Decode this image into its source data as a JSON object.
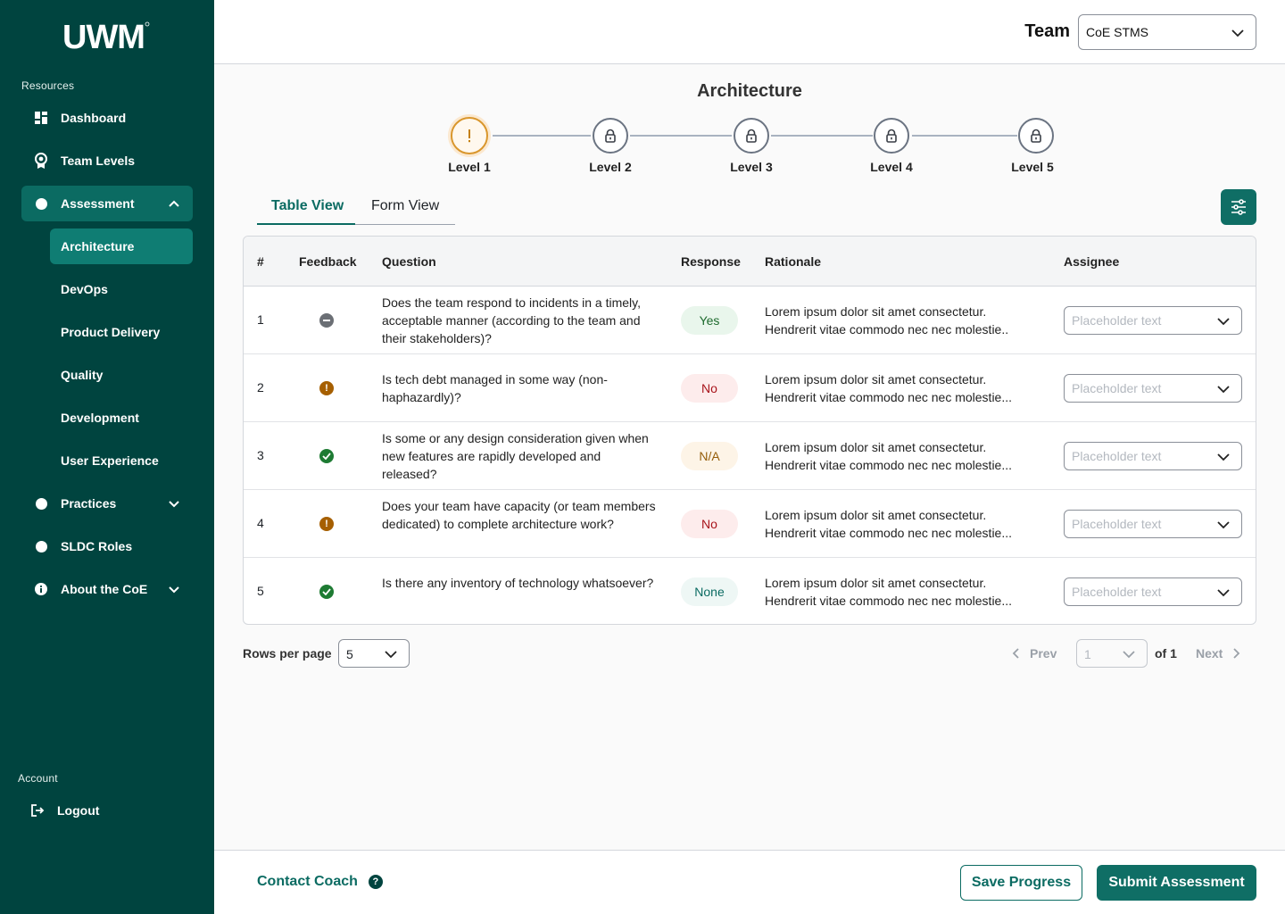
{
  "sidebar": {
    "logo_text": "UWM",
    "resources_label": "Resources",
    "items": {
      "dashboard": "Dashboard",
      "team_levels": "Team Levels",
      "assessment": "Assessment",
      "practices": "Practices",
      "sldc_roles": "SLDC Roles",
      "about": "About the CoE"
    },
    "assessment_subitems": [
      "Architecture",
      "DevOps",
      "Product Delivery",
      "Quality",
      "Development",
      "User Experience"
    ],
    "account_label": "Account",
    "logout": "Logout"
  },
  "header": {
    "team_label": "Team",
    "team_value": "CoE STMS"
  },
  "page": {
    "title": "Architecture",
    "levels": [
      "Level 1",
      "Level 2",
      "Level 3",
      "Level 4",
      "Level 5"
    ],
    "tabs": [
      "Table View",
      "Form View"
    ]
  },
  "table": {
    "headers": [
      "#",
      "Feedback",
      "Question",
      "Response",
      "Rationale",
      "Assignee"
    ],
    "assignee_placeholder": "Placeholder text",
    "rows": [
      {
        "num": "1",
        "feedback": "neutral",
        "question": "Does the team respond to incidents in a timely, acceptable manner (according to the team and their stakeholders)?",
        "response": "Yes",
        "rationale_1": "Lorem ipsum dolor sit amet consectetur.",
        "rationale_2": "Hendrerit vitae commodo nec nec molestie.."
      },
      {
        "num": "2",
        "feedback": "warning",
        "question": "Is tech debt managed in some way (non-haphazardly)?",
        "response": "No",
        "rationale_1": "Lorem ipsum dolor sit amet consectetur.",
        "rationale_2": "Hendrerit vitae commodo nec nec molestie..."
      },
      {
        "num": "3",
        "feedback": "success",
        "question": "Is some or any design consideration given when new features are rapidly developed and released?",
        "response": "N/A",
        "rationale_1": "Lorem ipsum dolor sit amet consectetur.",
        "rationale_2": "Hendrerit vitae commodo nec nec molestie..."
      },
      {
        "num": "4",
        "feedback": "warning",
        "question": "Does your team have capacity (or team members dedicated) to complete architecture work?",
        "response": "No",
        "rationale_1": "Lorem ipsum dolor sit amet consectetur.",
        "rationale_2": "Hendrerit vitae commodo nec nec molestie..."
      },
      {
        "num": "5",
        "feedback": "success",
        "question": "Is there any inventory of technology whatsoever?",
        "response": "None",
        "rationale_1": "Lorem ipsum dolor sit amet consectetur.",
        "rationale_2": "Hendrerit vitae commodo nec nec molestie..."
      }
    ]
  },
  "pagination": {
    "rows_per_page_label": "Rows per page",
    "rows_per_page_value": "5",
    "prev": "Prev",
    "page_value": "1",
    "of_label": "of 1",
    "next": "Next"
  },
  "footer": {
    "contact": "Contact Coach",
    "help_glyph": "?",
    "save": "Save Progress",
    "submit": "Submit Assessment"
  },
  "colors": {
    "sidebar_bg": "#00443f",
    "accent": "#0f6e65",
    "warning": "#a65f00",
    "success": "#1e7b33",
    "neutral": "#6b6f75",
    "current_level": "#d9962c"
  }
}
